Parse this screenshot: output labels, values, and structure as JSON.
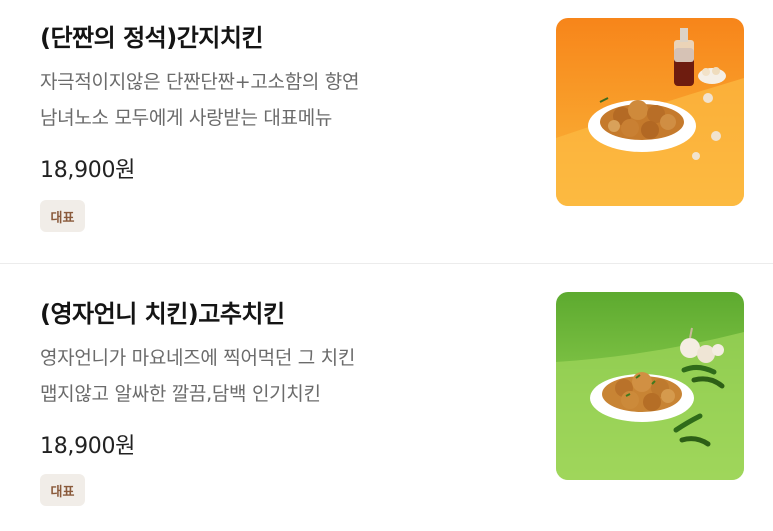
{
  "menu": {
    "items": [
      {
        "title": "(단짠의 정석)간지치킨",
        "description_lines": [
          "자극적이지않은 단짠단짠+고소함의 향연",
          "남녀노소 모두에게 사랑받는 대표메뉴"
        ],
        "price": "18,900원",
        "badge": "대표",
        "image_icon": "chicken-dish-photo",
        "image_background": "#f7931e"
      },
      {
        "title": "(영자언니 치킨)고추치킨",
        "description_lines": [
          "영자언니가 마요네즈에 찍어먹던 그 치킨",
          "맵지않고 알싸한 깔끔,담백 인기치킨"
        ],
        "price": "18,900원",
        "badge": "대표",
        "image_icon": "chicken-dish-photo",
        "image_background": "#7cc043"
      }
    ]
  }
}
